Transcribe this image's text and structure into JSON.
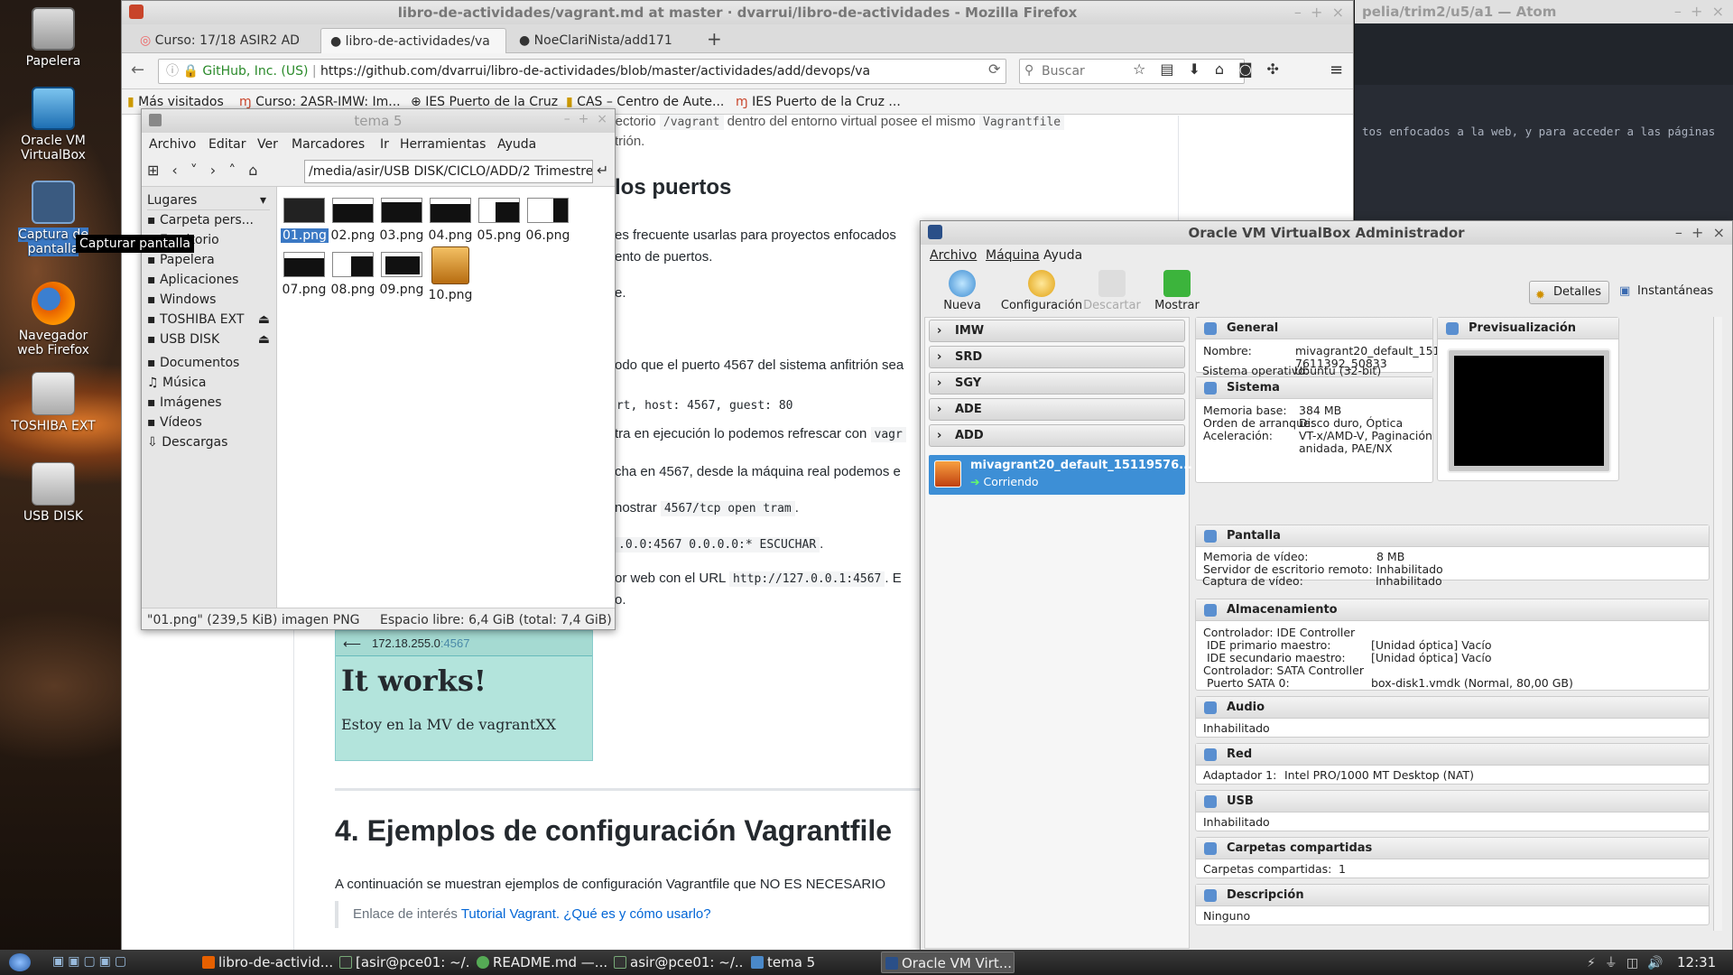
{
  "desktop": {
    "icons": [
      {
        "label": "Papelera",
        "icon": "trash-icon"
      },
      {
        "label": "Oracle VM VirtualBox",
        "icon": "virtualbox-icon"
      },
      {
        "label": "Captura de pantalla",
        "icon": "camera-icon"
      },
      {
        "label": "Navegador web Firefox",
        "icon": "firefox-icon"
      },
      {
        "label": "TOSHIBA EXT",
        "icon": "usb-drive-icon"
      },
      {
        "label": "USB DISK",
        "icon": "usb-drive-icon"
      }
    ],
    "tooltip": "Capturar pantalla"
  },
  "firefox": {
    "title": "libro-de-actividades/vagrant.md at master · dvarrui/libro-de-actividades - Mozilla Firefox",
    "tabs": [
      "Curso: 17/18 ASIR2 AD",
      "libro-de-actividades/va",
      "NoeClariNista/add171"
    ],
    "url_identity": "GitHub, Inc. (US)",
    "url": "https://github.com/dvarrui/libro-de-actividades/blob/master/actividades/add/devops/va",
    "search_placeholder": "Buscar",
    "bookmarks": [
      "Más visitados",
      "Curso: 2ASR-IMW: Im...",
      "IES Puerto de la Cruz",
      "CAS – Centro de Aute...",
      "IES Puerto de la Cruz ..."
    ],
    "page": {
      "p1": "directorio",
      "p1_code1": "/vagrant",
      "p1_b": "dentro del entorno virtual posee el mismo",
      "p1_code2": "Vagrantfile",
      "p1_end": "trión.",
      "h_ports": "los puertos",
      "p2": "es frecuente usarlas para proyectos enfocados",
      "p2b": "ento de puertos.",
      "p3": "e.",
      "p4": "odo que el puerto 4567 del sistema anfitrión sea",
      "code_fwd": "ort, host: 4567, guest: 80",
      "p5": "tra en ejecución lo podemos refrescar con",
      "p5_code": "vagr",
      "p6": "cha en 4567, desde la máquina real podemos e",
      "p7": "nostrar",
      "p7_code": "4567/tcp open tram",
      "p7_end": ".",
      "p8_code": ".0.0:4567 0.0.0.0:* ESCUCHAR",
      "p8_end": ".",
      "p9": "or web con el URL",
      "p9_code": "http://127.0.0.1:4567",
      "p9_end": ". E",
      "p10": "o.",
      "img_url": "172.18.255.0",
      "img_port": ":4567",
      "img_h": "It works!",
      "img_p": "Estoy en la MV de vagrantXX",
      "h4": "4. Ejemplos de configuración Vagrantfile",
      "p11": "A continuación se muestran ejemplos de configuración Vagrantfile que NO ES NECESARIO",
      "quote_pre": "Enlace de interés",
      "quote_link": "Tutorial Vagrant. ¿Qué es y cómo usarlo?"
    }
  },
  "atom": {
    "title": "pelia/trim2/u5/a1 — Atom",
    "text": "tos enfocados a la web, y para acceder a las páginas"
  },
  "filemanager": {
    "title": "tema 5",
    "menu": [
      "Archivo",
      "Editar",
      "Ver",
      "Marcadores",
      "Ir",
      "Herramientas",
      "Ayuda"
    ],
    "path": "/media/asir/USB DISK/CICLO/ADD/2 Trimestre",
    "places_label": "Lugares",
    "places": [
      "Carpeta pers...",
      "Escritorio",
      "Papelera",
      "Aplicaciones",
      "Windows",
      "TOSHIBA EXT",
      "USB DISK",
      "Documentos",
      "Música",
      "Imágenes",
      "Vídeos",
      "Descargas"
    ],
    "files": [
      "01.png",
      "02.png",
      "03.png",
      "04.png",
      "05.png",
      "06.png",
      "07.png",
      "08.png",
      "09.png",
      "10.png"
    ],
    "status_left": "\"01.png\" (239,5 KiB) imagen PNG",
    "status_right": "Espacio libre: 6,4 GiB (total: 7,4 GiB)"
  },
  "virtualbox": {
    "title": "Oracle VM VirtualBox Administrador",
    "menu": [
      "Archivo",
      "Máquina",
      "Ayuda"
    ],
    "tools": [
      "Nueva",
      "Configuración",
      "Descartar",
      "Mostrar"
    ],
    "views": [
      "Detalles",
      "Instantáneas"
    ],
    "groups": [
      "IMW",
      "SRD",
      "SGY",
      "ADE",
      "ADD"
    ],
    "vm": {
      "name": "mivagrant20_default_15119576...",
      "state": "Corriendo"
    },
    "general": {
      "title": "General",
      "rows": [
        [
          "Nombre:",
          "mivagrant20_default_151195\n7611392_50833"
        ],
        [
          "Sistema operativo:",
          "Ubuntu (32-bit)"
        ]
      ]
    },
    "preview": {
      "title": "Previsualización"
    },
    "system": {
      "title": "Sistema",
      "rows": [
        [
          "Memoria base:",
          "384 MB"
        ],
        [
          "Orden de arranque:",
          "Disco duro, Óptica"
        ],
        [
          "Aceleración:",
          "VT-x/AMD-V, Paginación\nanidada, PAE/NX"
        ]
      ]
    },
    "display": {
      "title": "Pantalla",
      "rows": [
        [
          "Memoria de vídeo:",
          "8 MB"
        ],
        [
          "Servidor de escritorio remoto:",
          "Inhabilitado"
        ],
        [
          "Captura de vídeo:",
          "Inhabilitado"
        ]
      ]
    },
    "storage": {
      "title": "Almacenamiento",
      "rows": [
        [
          "Controlador: IDE Controller",
          ""
        ],
        [
          " IDE primario maestro:",
          "[Unidad óptica] Vacío"
        ],
        [
          " IDE secundario maestro:",
          "[Unidad óptica] Vacío"
        ],
        [
          "Controlador: SATA Controller",
          ""
        ],
        [
          " Puerto SATA 0:",
          "box-disk1.vmdk (Normal, 80,00 GB)"
        ]
      ]
    },
    "audio": {
      "title": "Audio",
      "value": "Inhabilitado"
    },
    "network": {
      "title": "Red",
      "label": "Adaptador 1:",
      "value": "Intel PRO/1000 MT Desktop (NAT)"
    },
    "usb": {
      "title": "USB",
      "value": "Inhabilitado"
    },
    "shared": {
      "title": "Carpetas compartidas",
      "label": "Carpetas compartidas:",
      "value": "1"
    },
    "description": {
      "title": "Descripción",
      "value": "Ninguno"
    }
  },
  "taskbar": {
    "tasks": [
      "libro-de-activid...",
      "[asir@pce01: ~/...",
      "README.md —...",
      "asir@pce01: ~/...",
      "tema 5",
      "Oracle VM Virt..."
    ],
    "clock": "12:31"
  }
}
